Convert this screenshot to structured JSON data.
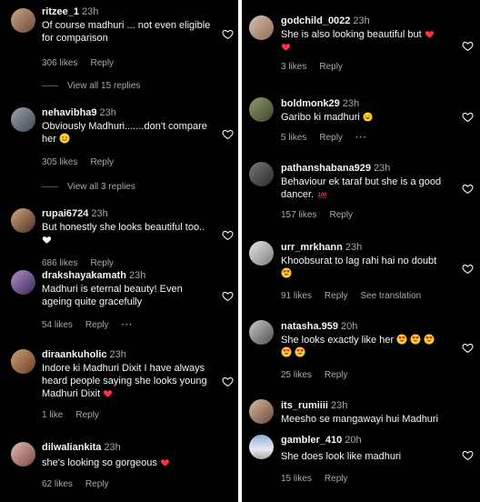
{
  "left_column": {
    "comments": [
      {
        "username": "ritzee_1",
        "time": "23h",
        "text": "Of course madhuri ... not even eligible for comparison",
        "likes": "306 likes",
        "reply": "Reply",
        "view_replies": "View all 15 replies"
      },
      {
        "username": "nehavibha9",
        "time": "23h",
        "text": "Obviously Madhuri.......don't compare her",
        "likes": "305 likes",
        "reply": "Reply",
        "view_replies": "View all 3 replies"
      },
      {
        "username": "rupai6724",
        "time": "23h",
        "text": "But honestly she looks beautiful too..",
        "likes": "686 likes",
        "reply": "Reply"
      },
      {
        "username": "drakshayakamath",
        "time": "23h",
        "text": "Madhuri is eternal beauty! Even ageing quite gracefully",
        "likes": "54 likes",
        "reply": "Reply",
        "more": "···"
      },
      {
        "username": "diraankuholic",
        "time": "23h",
        "text": "Indore ki Madhuri Dixit I have always heard people saying she looks young Madhuri Dixit",
        "likes": "1 like",
        "reply": "Reply"
      },
      {
        "username": "dilwaliankita",
        "time": "23h",
        "text": "she's looking so gorgeous",
        "likes": "62 likes",
        "reply": "Reply"
      }
    ]
  },
  "right_column": {
    "comments": [
      {
        "username": "godchild_0022",
        "time": "23h",
        "text": "She is also looking beautiful but",
        "likes": "3 likes",
        "reply": "Reply"
      },
      {
        "username": "boldmonk29",
        "time": "23h",
        "text": "Garibo ki madhuri",
        "likes": "5 likes",
        "reply": "Reply",
        "more": "···"
      },
      {
        "username": "pathanshabana929",
        "time": "23h",
        "text": "Behaviour ek taraf but she is a good dancer.",
        "likes": "157 likes",
        "reply": "Reply"
      },
      {
        "username": "urr_mrkhann",
        "time": "23h",
        "text": "Khoobsurat to lag rahi hai no doubt",
        "likes": "91 likes",
        "reply": "Reply",
        "see_translation": "See translation"
      },
      {
        "username": "natasha.959",
        "time": "20h",
        "text": "She looks exactly like her",
        "likes": "25 likes",
        "reply": "Reply"
      },
      {
        "username": "its_rumiiii",
        "time": "23h",
        "text": "Meesho se mangawayi hui Madhuri"
      },
      {
        "username": "gambler_410",
        "time": "20h",
        "text": "She does look like madhuri",
        "likes": "15 likes",
        "reply": "Reply"
      }
    ]
  },
  "colors": {
    "background": "#000000",
    "text": "#f5f5f5",
    "secondary": "#a8a8a8",
    "red_heart": "#ff3040",
    "divider": "#ffffff"
  },
  "icons": {
    "like": "heart-outline-icon"
  }
}
